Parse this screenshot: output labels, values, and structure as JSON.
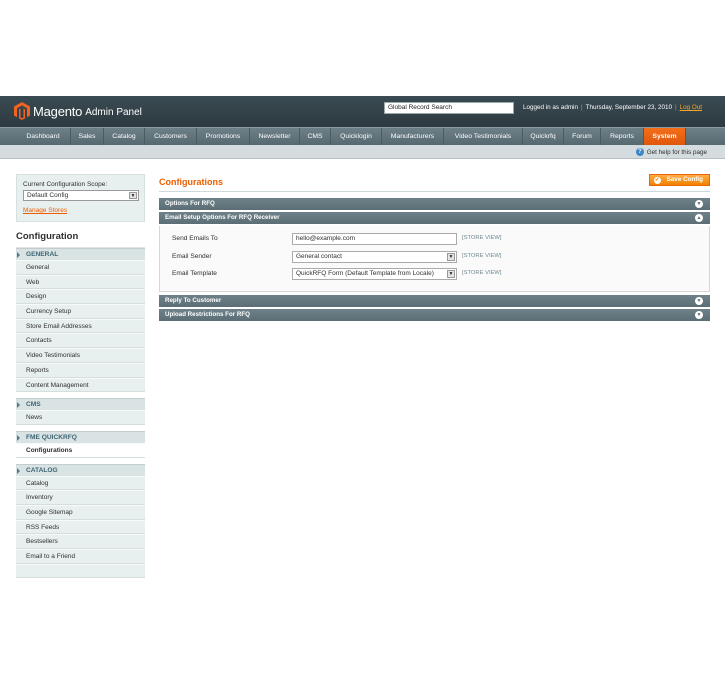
{
  "header": {
    "logo_name": "Magento",
    "logo_sub": "Admin Panel",
    "search_value": "Global Record Search",
    "logged_in": "Logged in as admin",
    "date": "Thursday, September 23, 2010",
    "logout": "Log Out"
  },
  "nav": [
    "Dashboard",
    "Sales",
    "Catalog",
    "Customers",
    "Promotions",
    "Newsletter",
    "CMS",
    "Quicklogin",
    "Manufacturers",
    "Video Testimonials",
    "Quickrfq",
    "Forum",
    "Reports",
    "System"
  ],
  "help": "Get help for this page",
  "sidebar": {
    "scope_label": "Current Configuration Scope:",
    "scope_value": "Default Config",
    "manage_stores": "Manage Stores",
    "title": "Configuration",
    "sections": [
      {
        "label": "GENERAL",
        "items": [
          "General",
          "Web",
          "Design",
          "Currency Setup",
          "Store Email Addresses",
          "Contacts",
          "Video Testimonials",
          "Reports",
          "Content Management"
        ]
      },
      {
        "label": "CMS",
        "items": [
          "News"
        ]
      },
      {
        "label": "FME QUICKRFQ",
        "items": [
          "Configurations"
        ]
      },
      {
        "label": "CATALOG",
        "items": [
          "Catalog",
          "Inventory",
          "Google Sitemap",
          "RSS Feeds",
          "Bestsellers",
          "Email to a Friend"
        ]
      }
    ]
  },
  "main": {
    "title": "Configurations",
    "save_label": "Save Config",
    "fieldsets": [
      "Options For RFQ",
      "Email Setup Options For RFQ Receiver",
      "Reply To Customer",
      "Upload Restrictions For RFQ"
    ],
    "rows": [
      {
        "label": "Send Emails To",
        "value": "hello@example.com",
        "scope": "[STORE VIEW]"
      },
      {
        "label": "Email Sender",
        "value": "General contact",
        "scope": "[STORE VIEW]"
      },
      {
        "label": "Email Template",
        "value": "QuickRFQ Form (Default Template from Locale)",
        "scope": "[STORE VIEW]"
      }
    ]
  },
  "colors": {
    "accent": "#eb5e00",
    "header": "#2d3a40",
    "nav": "#5f7179",
    "active_tab": "#e8600f"
  },
  "icons": {
    "help": "question-circle-icon",
    "save": "check-circle-icon",
    "toggle": "collapse-circle-icon"
  }
}
